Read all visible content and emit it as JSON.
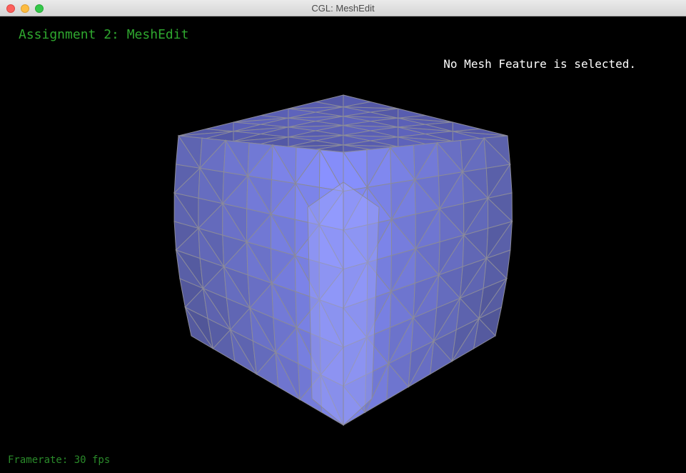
{
  "window": {
    "title": "CGL: MeshEdit"
  },
  "app": {
    "heading": "Assignment 2: MeshEdit",
    "status": "No Mesh Feature is selected.",
    "framerate": "Framerate: 30 fps"
  },
  "colors": {
    "background": "#000000",
    "heading": "#2fa82f",
    "framerate": "#2a8a2a",
    "status": "#ffffff",
    "mesh_face": "#8088f0",
    "mesh_edge": "#8a8a9a"
  }
}
